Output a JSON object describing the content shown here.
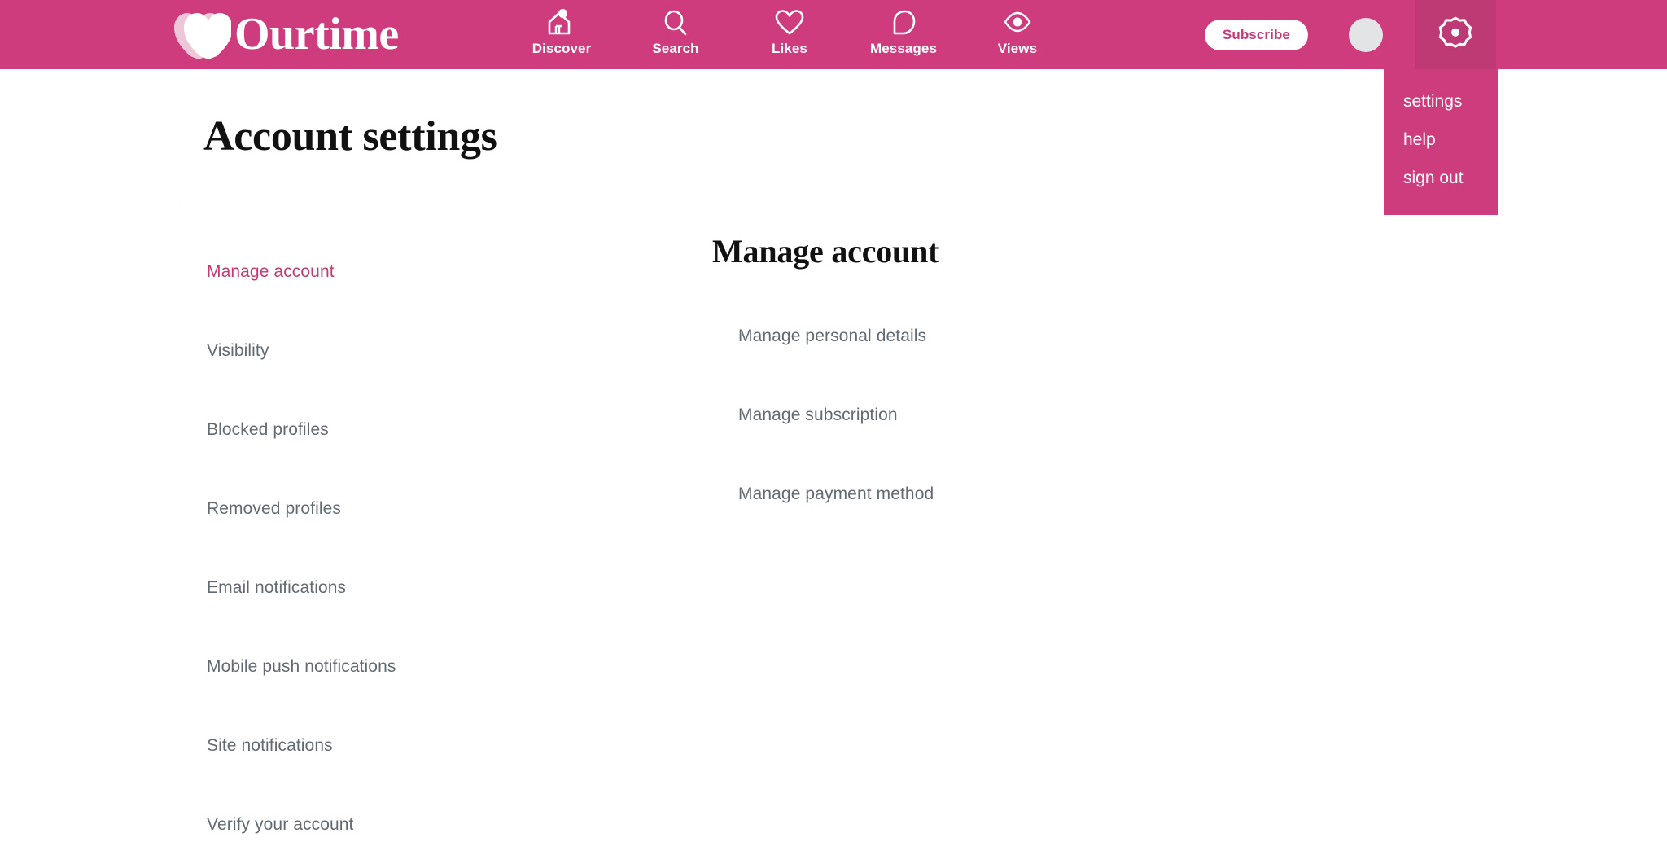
{
  "brand": {
    "name": "Ourtime",
    "logo_icon": "double-heart-icon",
    "header_color": "#cf3c7e",
    "accent_color": "#c13a70",
    "hover_color": "#bd3a74"
  },
  "header": {
    "nav": [
      {
        "label": "Discover",
        "icon": "home-icon",
        "badge": true
      },
      {
        "label": "Search",
        "icon": "search-icon",
        "badge": false
      },
      {
        "label": "Likes",
        "icon": "heart-icon",
        "badge": false
      },
      {
        "label": "Messages",
        "icon": "message-bubble-icon",
        "badge": false
      },
      {
        "label": "Views",
        "icon": "eye-icon",
        "badge": false
      }
    ],
    "subscribe_label": "Subscribe",
    "avatar_icon": "avatar",
    "settings_icon": "gear-icon"
  },
  "dropdown": {
    "items": [
      {
        "label": "settings"
      },
      {
        "label": "help"
      },
      {
        "label": "sign out"
      }
    ]
  },
  "page": {
    "title": "Account settings"
  },
  "sidebar": {
    "items": [
      {
        "label": "Manage account",
        "active": true
      },
      {
        "label": "Visibility",
        "active": false
      },
      {
        "label": "Blocked profiles",
        "active": false
      },
      {
        "label": "Removed profiles",
        "active": false
      },
      {
        "label": "Email notifications",
        "active": false
      },
      {
        "label": "Mobile push notifications",
        "active": false
      },
      {
        "label": "Site notifications",
        "active": false
      },
      {
        "label": "Verify your account",
        "active": false
      }
    ]
  },
  "main": {
    "title": "Manage account",
    "links": [
      {
        "label": "Manage personal details"
      },
      {
        "label": "Manage subscription"
      },
      {
        "label": "Manage payment method"
      }
    ]
  }
}
